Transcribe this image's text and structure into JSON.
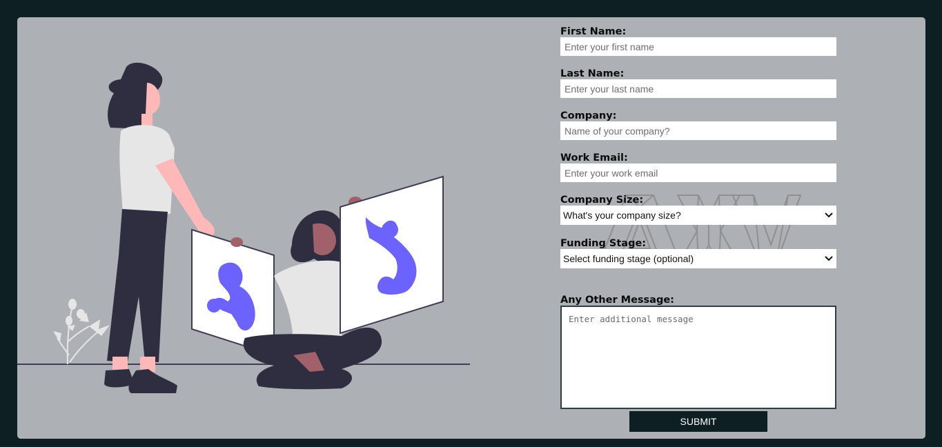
{
  "form": {
    "first_name": {
      "label": "First Name:",
      "placeholder": "Enter your first name",
      "value": ""
    },
    "last_name": {
      "label": "Last Name:",
      "placeholder": "Enter your last name",
      "value": ""
    },
    "company": {
      "label": "Company:",
      "placeholder": "Name of your company?",
      "value": ""
    },
    "work_email": {
      "label": "Work Email:",
      "placeholder": "Enter your work email",
      "value": ""
    },
    "company_size": {
      "label": "Company Size:",
      "selected": "What's your company size?"
    },
    "funding_stage": {
      "label": "Funding Stage:",
      "selected": "Select funding stage (optional)"
    },
    "message": {
      "label": "Any Other Message:",
      "placeholder": "Enter additional message",
      "value": ""
    },
    "submit_label": "SUBMIT"
  },
  "watermark": {
    "text": "AXV"
  },
  "colors": {
    "page_background": "#0e1f24",
    "panel_background": "#adb0b5",
    "accent_purple": "#6c63ff",
    "figure_dark": "#2f2e41",
    "skin": "#ffb8b8",
    "shirt": "#e6e6e6"
  },
  "icons": {
    "select_arrow": "chevron-down-icon"
  }
}
